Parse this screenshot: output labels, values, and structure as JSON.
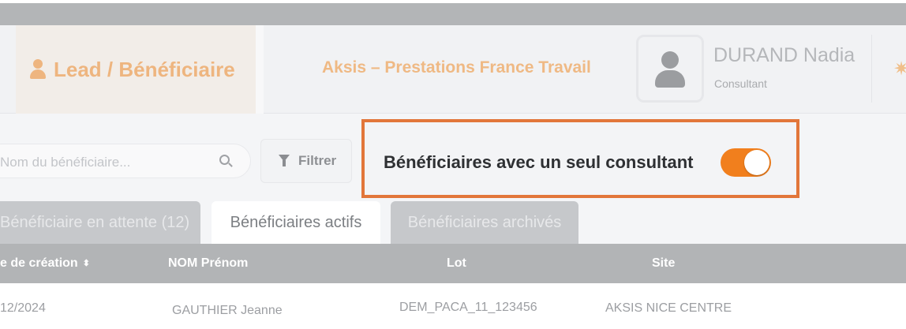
{
  "header": {
    "lead_tab_label": "Lead / Bénéficiaire",
    "organization": "Aksis – Prestations France Travail",
    "user": {
      "name": "DURAND Nadia",
      "role": "Consultant"
    }
  },
  "toolbar": {
    "search_placeholder": "Nom du bénéficiaire...",
    "filter_label": "Filtrer",
    "toggle_label": "Bénéficiaires avec un seul consultant",
    "toggle_on": true
  },
  "tabs": [
    {
      "label": "Bénéficiaire en attente (12)",
      "active": false
    },
    {
      "label": "Bénéficiaires actifs",
      "active": true
    },
    {
      "label": "Bénéficiaires archivés",
      "active": false
    }
  ],
  "table": {
    "columns": [
      "e de création",
      "NOM Prénom",
      "Lot",
      "Site"
    ],
    "rows": [
      [
        "12/2024",
        "GAUTHIER Jeanne",
        "DEM_PACA_11_123456",
        "AKSIS NICE CENTRE"
      ]
    ]
  },
  "colors": {
    "accent_orange": "#f17f1d",
    "highlight_border": "#e2763a",
    "header_text_faded": "#eeb57f"
  }
}
